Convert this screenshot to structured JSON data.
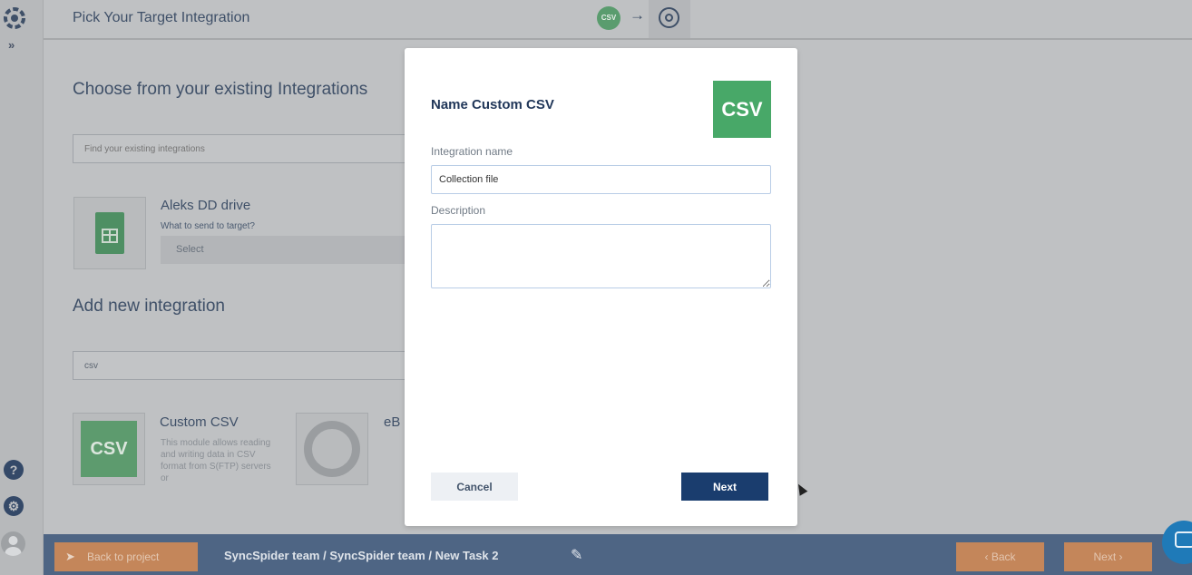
{
  "header": {
    "title": "Pick Your Target Integration",
    "step_source_label": "CSV",
    "step_arrow": "→"
  },
  "rail": {
    "expand": "»",
    "help": "?",
    "settings": "⚙"
  },
  "background": {
    "existing_heading": "Choose from your existing Integrations",
    "existing_search_placeholder": "Find your existing integrations",
    "existing_card": {
      "title": "Aleks DD drive",
      "question": "What to send to target?",
      "select_value": "Select"
    },
    "add_new_heading": "Add new integration",
    "add_new_search_value": "csv",
    "results": [
      {
        "title": "Custom CSV",
        "tile": "CSV",
        "description": "This module allows reading and writing data in CSV format from S(FTP) servers or"
      },
      {
        "title": "eB",
        "tile": ""
      }
    ]
  },
  "footer": {
    "back_to_project": "Back to project",
    "breadcrumb": "SyncSpider team  /  SyncSpider team  /  New Task 2",
    "back": "Back",
    "next": "Next"
  },
  "modal": {
    "title": "Name Custom CSV",
    "badge": "CSV",
    "name_label": "Integration name",
    "name_value": "Collection file",
    "description_label": "Description",
    "description_value": "",
    "cancel": "Cancel",
    "next": "Next"
  },
  "colors": {
    "accent_navy": "#1a3d6e",
    "csv_green": "#48a868",
    "footer_bar": "#4e6584",
    "footer_button": "#c4865a"
  }
}
